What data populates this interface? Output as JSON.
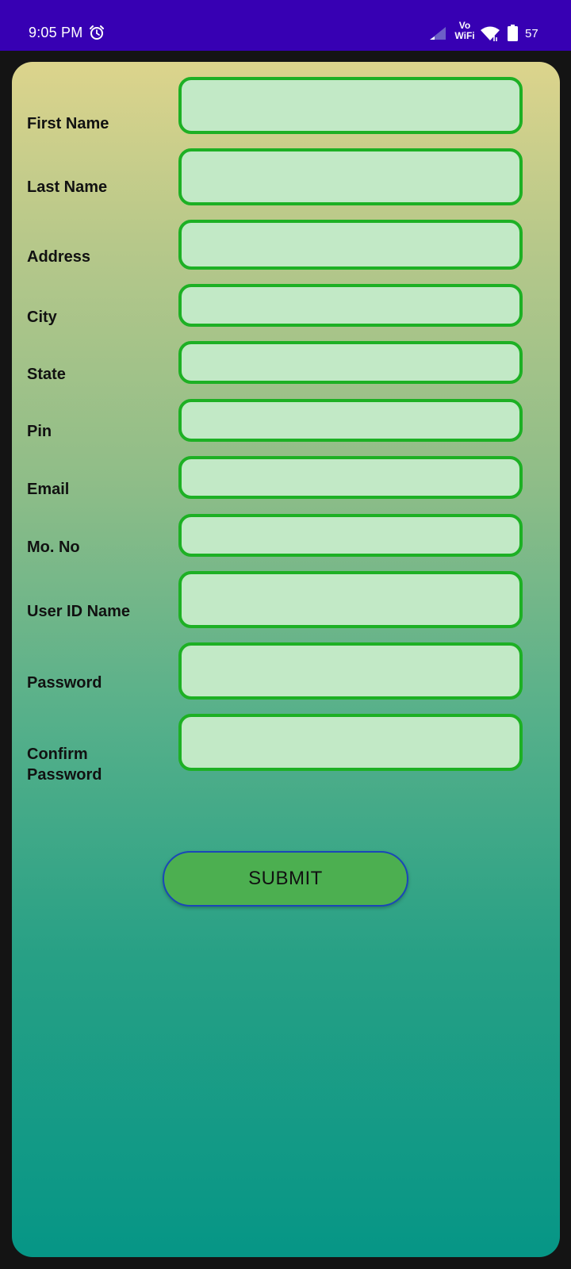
{
  "status_bar": {
    "time": "9:05 PM",
    "vowifi_top": "Vo",
    "vowifi_bottom": "WiFi",
    "battery_level": "57",
    "icons": [
      "alarm-icon",
      "signal-icon",
      "wifi-icon",
      "battery-icon"
    ],
    "background_color": "#3700b3"
  },
  "form": {
    "fields": [
      {
        "label": "First Name",
        "value": ""
      },
      {
        "label": "Last Name",
        "value": ""
      },
      {
        "label": "Address",
        "value": ""
      },
      {
        "label": "City",
        "value": ""
      },
      {
        "label": "State",
        "value": ""
      },
      {
        "label": "Pin",
        "value": ""
      },
      {
        "label": "Email",
        "value": ""
      },
      {
        "label": "Mo. No",
        "value": ""
      },
      {
        "label": "User ID Name",
        "value": ""
      },
      {
        "label": "Password",
        "value": ""
      },
      {
        "label": "Confirm Password",
        "value": ""
      }
    ],
    "submit_label": "SUBMIT",
    "colors": {
      "field_fill": "#c2e9c6",
      "field_border": "#1db024",
      "button_fill": "#4caf50",
      "button_border": "#1a47b8",
      "gradient_top": "#dcd48c",
      "gradient_bottom": "#069686"
    }
  }
}
